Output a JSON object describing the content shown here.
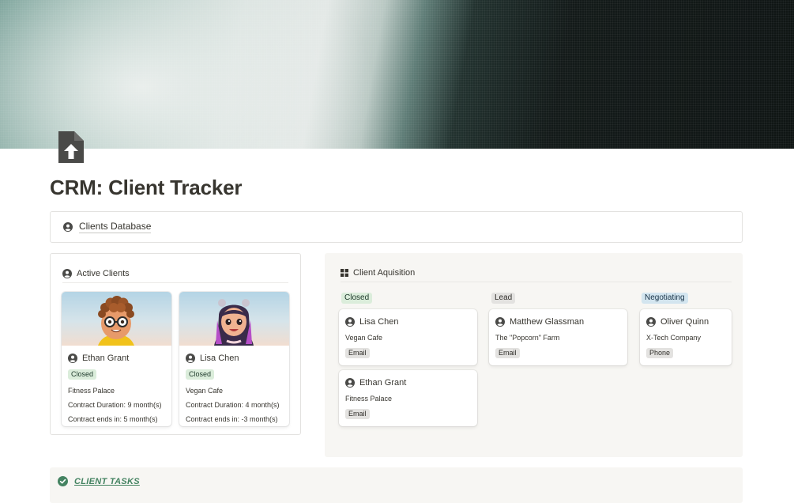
{
  "page": {
    "title": "CRM: Client Tracker",
    "icon": "file-upload-icon"
  },
  "database_link": {
    "label": "Clients Database",
    "icon": "person-icon"
  },
  "active_clients": {
    "title": "Active Clients",
    "cards": [
      {
        "name": "Ethan Grant",
        "avatar": "boy-with-glasses-avatar",
        "status": "Closed",
        "company": "Fitness Palace",
        "duration": "Contract Duration: 9 month(s)",
        "ends": "Contract ends in: 5 month(s)"
      },
      {
        "name": "Lisa Chen",
        "avatar": "girl-with-pigtails-avatar",
        "status": "Closed",
        "company": "Vegan Cafe",
        "duration": "Contract Duration: 4 month(s)",
        "ends": "Contract ends in: -3 month(s)"
      }
    ]
  },
  "acquisition": {
    "title": "Client Aquisition",
    "columns": [
      {
        "label": "Closed",
        "color": "#dbeddb",
        "cards": [
          {
            "name": "Lisa Chen",
            "company": "Vegan Cafe",
            "channel": "Email"
          },
          {
            "name": "Ethan Grant",
            "company": "Fitness Palace",
            "channel": "Email"
          }
        ]
      },
      {
        "label": "Lead",
        "color": "#e3e2e0",
        "cards": [
          {
            "name": "Matthew Glassman",
            "company": "The \"Popcorn\" Farm",
            "channel": "Email"
          }
        ]
      },
      {
        "label": "Negotiating",
        "color": "#d3e5ef",
        "cards": [
          {
            "name": "Oliver Quinn",
            "company": "X-Tech Company",
            "channel": "Phone"
          }
        ]
      }
    ]
  },
  "tasks": {
    "label": "CLIENT TASKS",
    "icon": "check-circle-icon",
    "color": "#448361"
  }
}
